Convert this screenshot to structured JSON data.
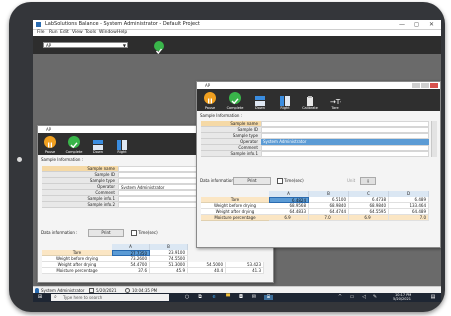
{
  "app": {
    "title": "LabSolutions Balance - System Administrator - Default Project",
    "controls": [
      "—",
      "◻",
      "✕"
    ]
  },
  "menu": [
    "File",
    "Run",
    "Edit",
    "View",
    "Tools",
    "Window",
    "Help"
  ],
  "toolbar": {
    "combo_value": "AP",
    "run_label": "Run"
  },
  "win1": {
    "title": "AP",
    "toolbar": [
      "Pause",
      "Complete",
      "Down",
      "Right"
    ],
    "sample_info_label": "Sample Information :",
    "fields": [
      {
        "label": "Sample name",
        "value": ""
      },
      {
        "label": "Sample ID",
        "value": ""
      },
      {
        "label": "Sample type",
        "value": ""
      },
      {
        "label": "Operator",
        "value": "System Administrator"
      },
      {
        "label": "Comment",
        "value": ""
      },
      {
        "label": "Sample info.1",
        "value": ""
      },
      {
        "label": "Sample info.2",
        "value": ""
      }
    ],
    "data_info_label": "Data information :",
    "print_btn": "Print",
    "time_label": "Time(sec)",
    "columns": [
      "A",
      "B"
    ],
    "rows": [
      {
        "label": "Tare",
        "values": [
          "27.7350",
          "23.9100"
        ]
      },
      {
        "label": "Weight before drying",
        "values": [
          "73.2600",
          "74.5500"
        ]
      },
      {
        "label": "Weight after drying",
        "values": [
          "54.4700",
          "51.3000",
          "54.5000",
          "53.423"
        ]
      },
      {
        "label": "Moisture percentage",
        "values": [
          "37.6",
          "45.9",
          "40.4",
          "41.3"
        ]
      }
    ]
  },
  "win2": {
    "title": "AP",
    "toolbar": [
      "Pause",
      "Complete",
      "Down",
      "Right",
      "Calibrate",
      "Tare"
    ],
    "sample_info_label": "Sample Information :",
    "fields": [
      {
        "label": "Sample name",
        "value": ""
      },
      {
        "label": "Sample ID",
        "value": ""
      },
      {
        "label": "Sample type",
        "value": ""
      },
      {
        "label": "Operator",
        "value": "System Administrator"
      },
      {
        "label": "Comment",
        "value": ""
      },
      {
        "label": "Sample info.1",
        "value": ""
      }
    ],
    "data_info_label": "Data information :",
    "print_btn": "Print",
    "time_label": "Time(sec)",
    "unit_label": "Unit",
    "unit_value": "g",
    "columns": [
      "A",
      "B",
      "C",
      "D"
    ],
    "rows": [
      {
        "label": "Tare",
        "values": [
          "6.4824",
          "6.5100",
          "6.4738",
          "6.489"
        ]
      },
      {
        "label": "Weight before drying",
        "values": [
          "68.9568",
          "68.9840",
          "68.9840",
          "133.464"
        ]
      },
      {
        "label": "Weight after drying",
        "values": [
          "64.4833",
          "64.4744",
          "64.5595",
          "64.489"
        ]
      },
      {
        "label": "Moisture percentage",
        "values": [
          "6.9",
          "7.0",
          "6.9",
          "7.0"
        ]
      }
    ]
  },
  "statusbar": {
    "user": "System Administrator",
    "date": "5/20/2021",
    "time": "10:04:35 PM"
  },
  "taskbar": {
    "search_placeholder": "Type here to search",
    "clock_time": "10:17 PM",
    "clock_date": "5/20/2021"
  }
}
